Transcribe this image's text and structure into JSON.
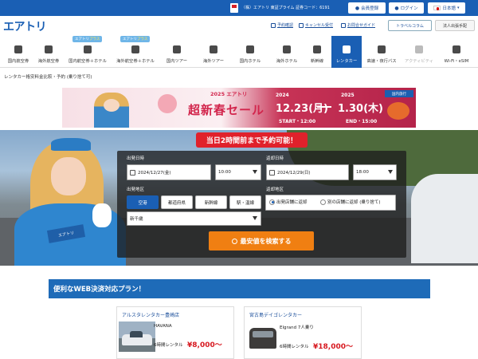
{
  "topbar": {
    "corp_text": "（株）エアトリ 東証プライム 証券コード：6191",
    "member_label": "会員登録",
    "login_label": "ログイン",
    "language_label": "日本語"
  },
  "header": {
    "logo": "エアトリ",
    "reservation_check": "予約確認",
    "cancel_accept": "キャンセル受付",
    "help_guide": "お問合せガイド",
    "travel_column": "トラベルコラム",
    "corporate": "法人出張手配"
  },
  "nav": {
    "badge_plus_label": "エアトリ",
    "badge_plus_suffix": "プラス",
    "items": [
      {
        "label": "国内航空券",
        "selected": false,
        "icon": "airplane-icon"
      },
      {
        "label": "海外航空券",
        "selected": false,
        "icon": "globe-icon"
      },
      {
        "label": "国内航空券＋ホテル",
        "selected": false,
        "icon": "plane-hotel-icon"
      },
      {
        "label": "海外航空券＋ホテル",
        "selected": false,
        "icon": "plane-hotel-icon"
      },
      {
        "label": "国内ツアー",
        "selected": false,
        "icon": "suitcase-icon"
      },
      {
        "label": "海外ツアー",
        "selected": false,
        "icon": "suitcase-icon"
      },
      {
        "label": "国内ホテル",
        "selected": false,
        "icon": "hotel-icon"
      },
      {
        "label": "海外ホテル",
        "selected": false,
        "icon": "hotel-icon"
      },
      {
        "label": "新幹線",
        "selected": false,
        "icon": "train-icon"
      },
      {
        "label": "レンタカー",
        "selected": true,
        "icon": "car-icon"
      },
      {
        "label": "高速・夜行バス",
        "selected": false,
        "icon": "bus-icon"
      },
      {
        "label": "アクティビティ",
        "selected": false,
        "icon": "activity-icon"
      },
      {
        "label": "Wi-Fi・eSIM",
        "selected": false,
        "icon": "wifi-icon"
      }
    ]
  },
  "breadcrumb": "レンタカー格安料金比較・予約 (乗り捨て可)",
  "banner": {
    "title": "2025 エアトリ",
    "main": "超新春セール",
    "year_start": "2024",
    "year_end": "2025",
    "date_start": "12.23(月)",
    "date_end": "1.30(木)",
    "start_text": "START・12:00",
    "end_text": "END・15:00",
    "tag": "国内旅行"
  },
  "hero": {
    "notice": "当日2時間前まで予約可能！",
    "sign_text": "エアトリ"
  },
  "form": {
    "depart_datetime_label": "出発日時",
    "depart_date": "2024/12/27(金)",
    "depart_time": "10:00",
    "return_datetime_label": "返却日時",
    "return_date": "2024/12/29(日)",
    "return_time": "18:00",
    "depart_area_label": "出発地区",
    "area_tabs": [
      {
        "label": "空港",
        "selected": true
      },
      {
        "label": "都道府県",
        "selected": false
      },
      {
        "label": "新幹線",
        "selected": false
      },
      {
        "label": "駅・温線",
        "selected": false
      }
    ],
    "depart_location": "新千歳",
    "return_area_label": "返却地区",
    "return_options": [
      {
        "label": "出発店舗に返却",
        "checked": true
      },
      {
        "label": "別の店舗に返却 (乗り捨て)",
        "checked": false
      }
    ],
    "search_label": "最安値を検索する"
  },
  "plans": {
    "heading": "便利なWEB決済対応プラン！",
    "cards": [
      {
        "company": "アルスタレンタカー豊崎店",
        "model": "HAVANA",
        "plan": "6時間レンタル",
        "price": "¥8,000～"
      },
      {
        "company": "宮古島デイゴレンタカー",
        "model": "Elgrand 7人乗り",
        "plan": "6時間レンタル",
        "price": "¥18,000～"
      }
    ]
  },
  "colors": {
    "brand_blue": "#1a5fb4",
    "orange": "#f07f12",
    "red": "#e0212b",
    "price_red": "#d71920"
  }
}
